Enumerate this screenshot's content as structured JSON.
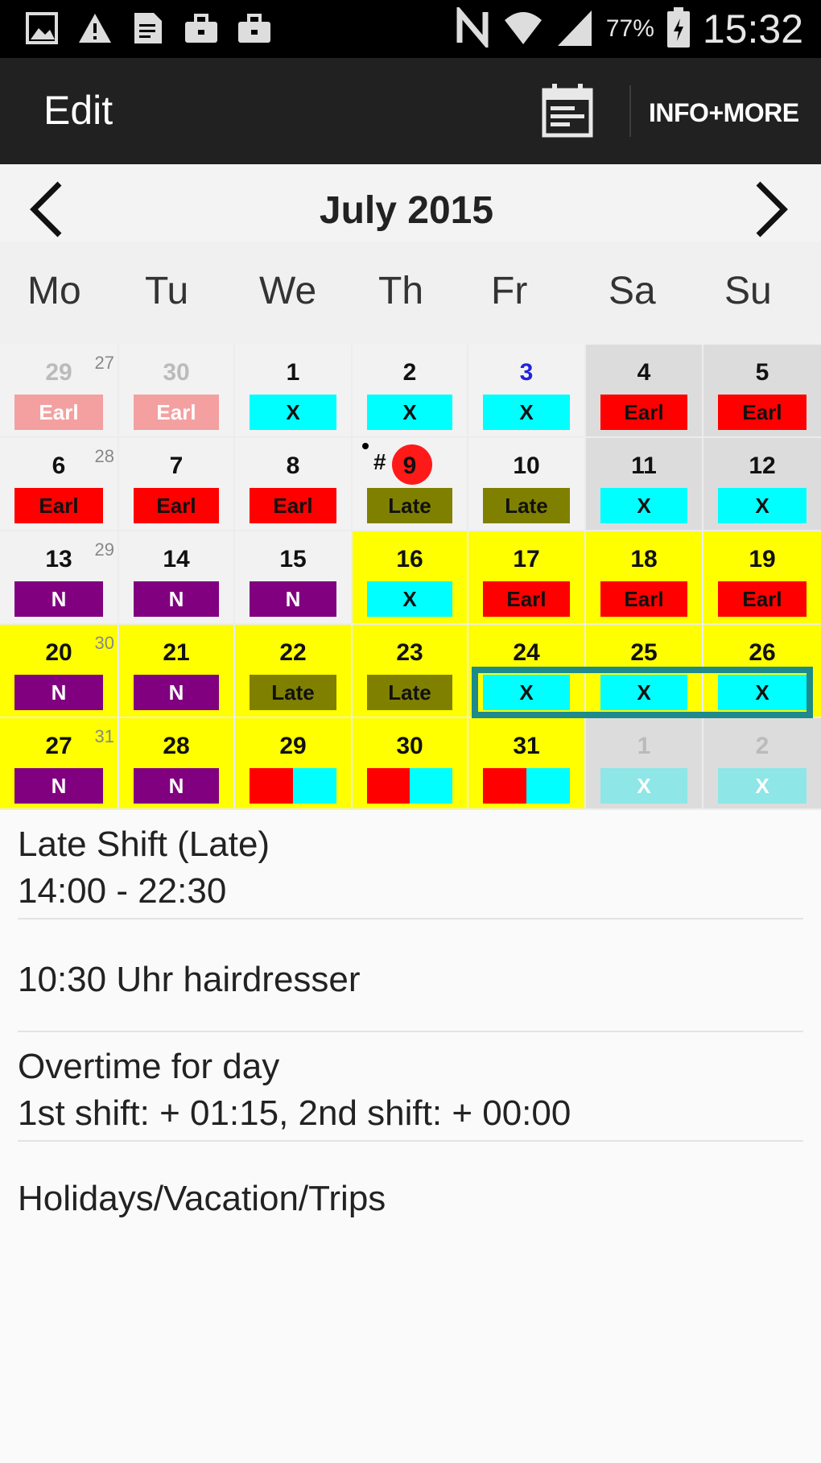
{
  "status_bar": {
    "time": "15:32",
    "battery_percent": "77%",
    "left_icons": [
      "gallery-icon",
      "warning-icon",
      "document-icon",
      "briefcase-icon",
      "briefcase-icon"
    ],
    "right_icons": [
      "nfc-icon",
      "wifi-icon",
      "signal-icon",
      "battery-icon"
    ]
  },
  "action_bar": {
    "title": "Edit",
    "calendar_icon": "calendar-icon",
    "menu_label": "INFO+MORE"
  },
  "month_nav": {
    "title": "July 2015",
    "prev_icon": "chevron-left-icon",
    "next_icon": "chevron-right-icon"
  },
  "weekdays": [
    "Mo",
    "Tu",
    "We",
    "Th",
    "Fr",
    "Sa",
    "Su"
  ],
  "shift_colors": {
    "Earl": "#ff0000",
    "Earl_faded": "#f4a0a0",
    "X": "#00ffff",
    "X_faded": "#8ee6e6",
    "Late": "#808000",
    "N": "#800080"
  },
  "calendar": {
    "weeks": [
      {
        "week_num": "27",
        "days": [
          {
            "day": "29",
            "muted": true,
            "shift": "Earl",
            "shift_label": "Earl"
          },
          {
            "day": "30",
            "muted": true,
            "shift": "Earl",
            "shift_label": "Earl"
          },
          {
            "day": "1",
            "shift": "X",
            "shift_label": "X"
          },
          {
            "day": "2",
            "shift": "X",
            "shift_label": "X"
          },
          {
            "day": "3",
            "day_color": "#2222dd",
            "shift": "X",
            "shift_label": "X"
          },
          {
            "day": "4",
            "shift": "Earl",
            "shift_label": "Earl"
          },
          {
            "day": "5",
            "shift": "Earl",
            "shift_label": "Earl"
          }
        ]
      },
      {
        "week_num": "28",
        "days": [
          {
            "day": "6",
            "shift": "Earl",
            "shift_label": "Earl"
          },
          {
            "day": "7",
            "shift": "Earl",
            "shift_label": "Earl"
          },
          {
            "day": "8",
            "shift": "Earl",
            "shift_label": "Earl"
          },
          {
            "day": "9",
            "today": true,
            "shift": "Late",
            "shift_label": "Late"
          },
          {
            "day": "10",
            "shift": "Late",
            "shift_label": "Late"
          },
          {
            "day": "11",
            "shift": "X",
            "shift_label": "X"
          },
          {
            "day": "12",
            "shift": "X",
            "shift_label": "X"
          }
        ]
      },
      {
        "week_num": "29",
        "days": [
          {
            "day": "13",
            "shift": "N",
            "shift_label": "N"
          },
          {
            "day": "14",
            "shift": "N",
            "shift_label": "N"
          },
          {
            "day": "15",
            "shift": "N",
            "shift_label": "N"
          },
          {
            "day": "16",
            "vacation": true,
            "shift": "X",
            "shift_label": "X"
          },
          {
            "day": "17",
            "vacation": true,
            "shift": "Earl",
            "shift_label": "Earl"
          },
          {
            "day": "18",
            "vacation": true,
            "shift": "Earl",
            "shift_label": "Earl"
          },
          {
            "day": "19",
            "vacation": true,
            "shift": "Earl",
            "shift_label": "Earl"
          }
        ]
      },
      {
        "week_num": "30",
        "days": [
          {
            "day": "20",
            "vacation": true,
            "shift": "N",
            "shift_label": "N"
          },
          {
            "day": "21",
            "vacation": true,
            "shift": "N",
            "shift_label": "N"
          },
          {
            "day": "22",
            "vacation": true,
            "shift": "Late",
            "shift_label": "Late"
          },
          {
            "day": "23",
            "vacation": true,
            "shift": "Late",
            "shift_label": "Late"
          },
          {
            "day": "24",
            "vacation": true,
            "shift": "X",
            "shift_label": "X"
          },
          {
            "day": "25",
            "vacation": true,
            "shift": "X",
            "shift_label": "X"
          },
          {
            "day": "26",
            "vacation": true,
            "shift": "X",
            "shift_label": "X"
          }
        ]
      },
      {
        "week_num": "31",
        "days": [
          {
            "day": "27",
            "vacation": true,
            "shift": "N",
            "shift_label": "N"
          },
          {
            "day": "28",
            "vacation": true,
            "shift": "N",
            "shift_label": "N"
          },
          {
            "day": "29",
            "vacation": true,
            "split": [
              "Earl",
              "X"
            ]
          },
          {
            "day": "30",
            "vacation": true,
            "split": [
              "Earl",
              "X"
            ]
          },
          {
            "day": "31",
            "vacation": true,
            "split": [
              "Earl",
              "X"
            ]
          },
          {
            "day": "1",
            "muted": true,
            "shift": "X",
            "shift_label": "X"
          },
          {
            "day": "2",
            "muted": true,
            "shift": "X",
            "shift_label": "X"
          }
        ]
      }
    ]
  },
  "details": {
    "shift_name": "Late Shift  (Late)",
    "shift_time": "14:00 - 22:30",
    "note": "10:30 Uhr hairdresser",
    "overtime_title": "Overtime for day",
    "overtime_value": "1st shift: + 01:15, 2nd shift: + 00:00",
    "holidays": "Holidays/Vacation/Trips"
  }
}
